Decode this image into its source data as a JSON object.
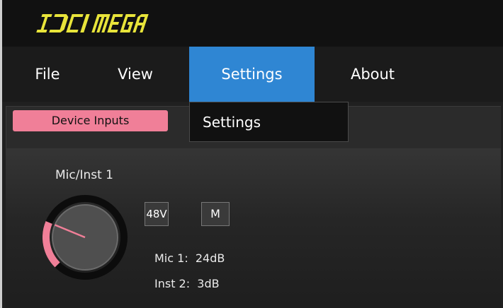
{
  "app": {
    "logo_text": "IDCI MEGA"
  },
  "menu": {
    "items": [
      {
        "label": "File"
      },
      {
        "label": "View"
      },
      {
        "label": "Settings"
      },
      {
        "label": "About"
      }
    ],
    "active_index": 2
  },
  "dropdown": {
    "items": [
      {
        "label": "Settings"
      }
    ]
  },
  "tabs": {
    "device_inputs": "Device Inputs"
  },
  "channel": {
    "name": "Mic/Inst 1",
    "phantom_label": "48V",
    "mono_label": "M",
    "mic_gain": "Mic 1:  24dB",
    "inst_gain": "Inst 2:  3dB",
    "knob_level": 0.25
  },
  "colors": {
    "accent_blue": "#2f86d3",
    "tab_pink": "#f07f98",
    "logo_yellow": "#e8e43a"
  }
}
